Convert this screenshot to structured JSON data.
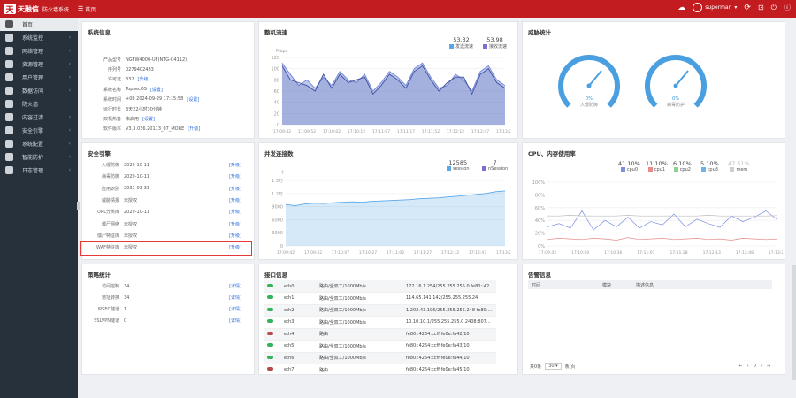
{
  "topbar": {
    "logo_mark": "天",
    "brand": "天融信",
    "system_name": "防火墙系统",
    "home_crumb": "首页",
    "user": "superman",
    "icons": [
      "cloud-icon",
      "user-icon",
      "refresh-icon",
      "lock-icon",
      "power-icon",
      "info-icon"
    ]
  },
  "sidebar": {
    "items": [
      {
        "label": "首页",
        "icon": "home-icon",
        "active": true
      },
      {
        "label": "系统监控",
        "icon": "monitor-icon",
        "arrow": "‹"
      },
      {
        "label": "网络管理",
        "icon": "network-icon",
        "arrow": "‹"
      },
      {
        "label": "资源管理",
        "icon": "resource-icon",
        "arrow": "‹"
      },
      {
        "label": "用户管理",
        "icon": "users-icon",
        "arrow": "‹"
      },
      {
        "label": "数据访问",
        "icon": "globe-icon",
        "arrow": "‹"
      },
      {
        "label": "防火墙",
        "icon": "firewall-icon"
      },
      {
        "label": "内容过滤",
        "icon": "filter-icon",
        "arrow": "‹"
      },
      {
        "label": "安全引擎",
        "icon": "shield-icon",
        "arrow": "‹"
      },
      {
        "label": "系统配置",
        "icon": "gear-icon",
        "arrow": "‹"
      },
      {
        "label": "智能防护",
        "icon": "protect-icon",
        "arrow": "‹"
      },
      {
        "label": "日志管理",
        "icon": "log-icon",
        "arrow": "‹"
      }
    ]
  },
  "sysinfo": {
    "title": "系统信息",
    "rows": [
      {
        "k": "产品型号",
        "v": "NGFW4000-UF(NTG-C4112)"
      },
      {
        "k": "序列号",
        "v": "0279402483"
      },
      {
        "k": "许可证",
        "v": "332",
        "l": "[升级]"
      },
      {
        "k": "系统名称",
        "v": "TopsecOS",
        "l": "[设置]"
      },
      {
        "k": "系统时间",
        "v": "+08 2024-09-29 17:15:58",
        "l": "[设置]"
      },
      {
        "k": "运行时长",
        "v": "3天22小时30分钟"
      },
      {
        "k": "双机热备",
        "v": "未启用",
        "l": "[设置]"
      },
      {
        "k": "软件版本",
        "v": "V3.3.036.20113_07_MORE",
        "l": "[升级]"
      }
    ]
  },
  "traffic": {
    "title": "整机流速",
    "unit": "Mbps",
    "legend": [
      {
        "value": "53.32",
        "name": "发送流速",
        "color": "#5aa7e8"
      },
      {
        "value": "53.98",
        "name": "接收流速",
        "color": "#7b6fd6"
      }
    ],
    "times": [
      "17:09:42",
      "17:09:52",
      "17:10:02",
      "17:10:12",
      "17:11:07",
      "17:11:17",
      "17:11:52",
      "17:12:12",
      "17:12:47",
      "17:13:22"
    ]
  },
  "threat": {
    "title": "威胁统计",
    "gauges": [
      {
        "pct": "0%",
        "name": "入侵防御"
      },
      {
        "pct": "0%",
        "name": "病毒防护"
      }
    ]
  },
  "engine": {
    "title": "安全引擎",
    "rows": [
      {
        "k": "入侵防御",
        "v": "2029-10-11",
        "l": "[升级]"
      },
      {
        "k": "病毒防御",
        "v": "2029-10-11",
        "l": "[升级]"
      },
      {
        "k": "应用识别",
        "v": "2031-03-31",
        "l": "[升级]"
      },
      {
        "k": "威胁情报",
        "v": "未授权",
        "l": "[升级]"
      },
      {
        "k": "URL分类库",
        "v": "2029-10-11",
        "l": "[升级]"
      },
      {
        "k": "僵尸网络",
        "v": "未授权",
        "l": "[升级]"
      },
      {
        "k": "僵尸特征库",
        "v": "未授权",
        "l": "[升级]"
      },
      {
        "k": "WAF特征库",
        "v": "未授权",
        "l": "[升级]"
      }
    ]
  },
  "conn": {
    "title": "并发连接数",
    "unit": "个",
    "legend": [
      {
        "value": "12585",
        "name": "session",
        "color": "#5aa7e8"
      },
      {
        "value": "7",
        "name": "nSession",
        "color": "#7b6fd6"
      }
    ],
    "yticks": [
      "1.5万",
      "1.2万",
      "9000",
      "6000",
      "3000",
      "0"
    ],
    "times": [
      "17:09:42",
      "17:09:52",
      "17:10:07",
      "17:10:27",
      "17:11:02",
      "17:11:27",
      "17:12:12",
      "17:12:47",
      "17:13:22"
    ]
  },
  "cpu": {
    "title": "CPU、内存使用率",
    "legend": [
      {
        "value": "41.10%",
        "name": "cpu0",
        "color": "#7b8fe0"
      },
      {
        "value": "11.10%",
        "name": "cpu1",
        "color": "#e88a8a"
      },
      {
        "value": "6.10%",
        "name": "cpu2",
        "color": "#8ed08e"
      },
      {
        "value": "5.10%",
        "name": "cpu3",
        "color": "#6ab7e6"
      },
      {
        "value": "47.51%",
        "name": "mem",
        "color": "#cfcfcf"
      }
    ],
    "yticks": [
      "100%",
      "80%",
      "60%",
      "40%",
      "20%",
      "0%"
    ],
    "times": [
      "17:09:42",
      "17:10:00",
      "17:10:36",
      "17:11:01",
      "17:11:28",
      "17:12:13",
      "17:12:48",
      "17:13:21"
    ]
  },
  "policy": {
    "title": "策略统计",
    "rows": [
      {
        "k": "访问控制",
        "v": "34",
        "l": "[详情]"
      },
      {
        "k": "地址转换",
        "v": "34",
        "l": "[详情]"
      },
      {
        "k": "IPSEC隧道",
        "v": "1",
        "l": "[详情]"
      },
      {
        "k": "SSLVPN隧道",
        "v": "0",
        "l": "[详情]"
      }
    ]
  },
  "ports": {
    "title": "接口信息",
    "rows": [
      {
        "name": "eth0",
        "mode": "路由/全双工/1000Mb/s",
        "addr": "172.16.1.254/255.255.255.0 fe80::42...",
        "color": "#33b35a"
      },
      {
        "name": "eth1",
        "mode": "路由/全双工/1000Mb/s",
        "addr": "114.65.141.142/255.255.255.24",
        "color": "#33b35a"
      },
      {
        "name": "eth2",
        "mode": "路由/全双工/1000Mb/s",
        "addr": "1.202.43.196/255.255.255.248 fe80:...",
        "color": "#33b35a"
      },
      {
        "name": "eth3",
        "mode": "路由/全双工/1000Mb/s",
        "addr": "10.10.10.1/255.255.255.0 2408:807...",
        "color": "#33b35a"
      },
      {
        "name": "eth4",
        "mode": "路由",
        "addr": "fe80::4264:ccff:fe0e:fa42/10",
        "color": "#b84a4a"
      },
      {
        "name": "eth5",
        "mode": "路由/全双工/1000Mb/s",
        "addr": "fe80::4264:ccff:fe0e:fa43/10",
        "color": "#33b35a"
      },
      {
        "name": "eth6",
        "mode": "路由/全双工/1000Mb/s",
        "addr": "fe80::4264:ccff:fe0e:fa44/10",
        "color": "#33b35a"
      },
      {
        "name": "eth7",
        "mode": "路由",
        "addr": "fe80::4264:ccff:fe0e:fa45/10",
        "color": "#b84a4a"
      }
    ]
  },
  "alarms": {
    "title": "告警信息",
    "columns": [
      "时间",
      "模块",
      "描述信息"
    ],
    "pager": {
      "total": "共0条",
      "size": "30",
      "per": "条/页",
      "page": "0"
    }
  },
  "chart_data": [
    {
      "type": "area",
      "title": "整机流速",
      "series": [
        {
          "name": "发送流速",
          "values": [
            110,
            90,
            70,
            80,
            65,
            85,
            70,
            95,
            80,
            75,
            90,
            60,
            75,
            95,
            85,
            70,
            100,
            110,
            85,
            65,
            70,
            90,
            80,
            60,
            95,
            105,
            80,
            70
          ]
        },
        {
          "name": "接收流速",
          "values": [
            105,
            80,
            75,
            70,
            60,
            90,
            65,
            90,
            75,
            80,
            85,
            55,
            70,
            90,
            80,
            65,
            95,
            105,
            80,
            60,
            75,
            85,
            85,
            55,
            90,
            100,
            75,
            65
          ]
        }
      ],
      "ylim": [
        0,
        120
      ]
    },
    {
      "type": "area",
      "title": "并发连接数",
      "series": [
        {
          "name": "session",
          "values": [
            9500,
            9200,
            9600,
            9800,
            9700,
            9900,
            10000,
            10100,
            10000,
            10200,
            10300,
            10400,
            10500,
            10600,
            10800,
            10900,
            11000,
            11200,
            11400,
            11600,
            11800,
            12000,
            12400,
            12585
          ]
        }
      ],
      "ylim": [
        0,
        15000
      ]
    },
    {
      "type": "line",
      "title": "CPU、内存使用率",
      "series": [
        {
          "name": "cpu0",
          "values": [
            30,
            35,
            28,
            55,
            25,
            40,
            30,
            45,
            28,
            38,
            33,
            50,
            30,
            42,
            35,
            29,
            47,
            38,
            45,
            55,
            41
          ]
        },
        {
          "name": "cpu1",
          "values": [
            10,
            12,
            11,
            10,
            12,
            11,
            9,
            13,
            10,
            11,
            12,
            10,
            11,
            12,
            10,
            11,
            9,
            12,
            11,
            10,
            11
          ]
        },
        {
          "name": "mem",
          "values": [
            47,
            47,
            48,
            47,
            47,
            47,
            47,
            48,
            47,
            47,
            47,
            47,
            47,
            47,
            48,
            47,
            47,
            47,
            47,
            47,
            47.5
          ]
        }
      ],
      "ylim": [
        0,
        100
      ]
    }
  ]
}
